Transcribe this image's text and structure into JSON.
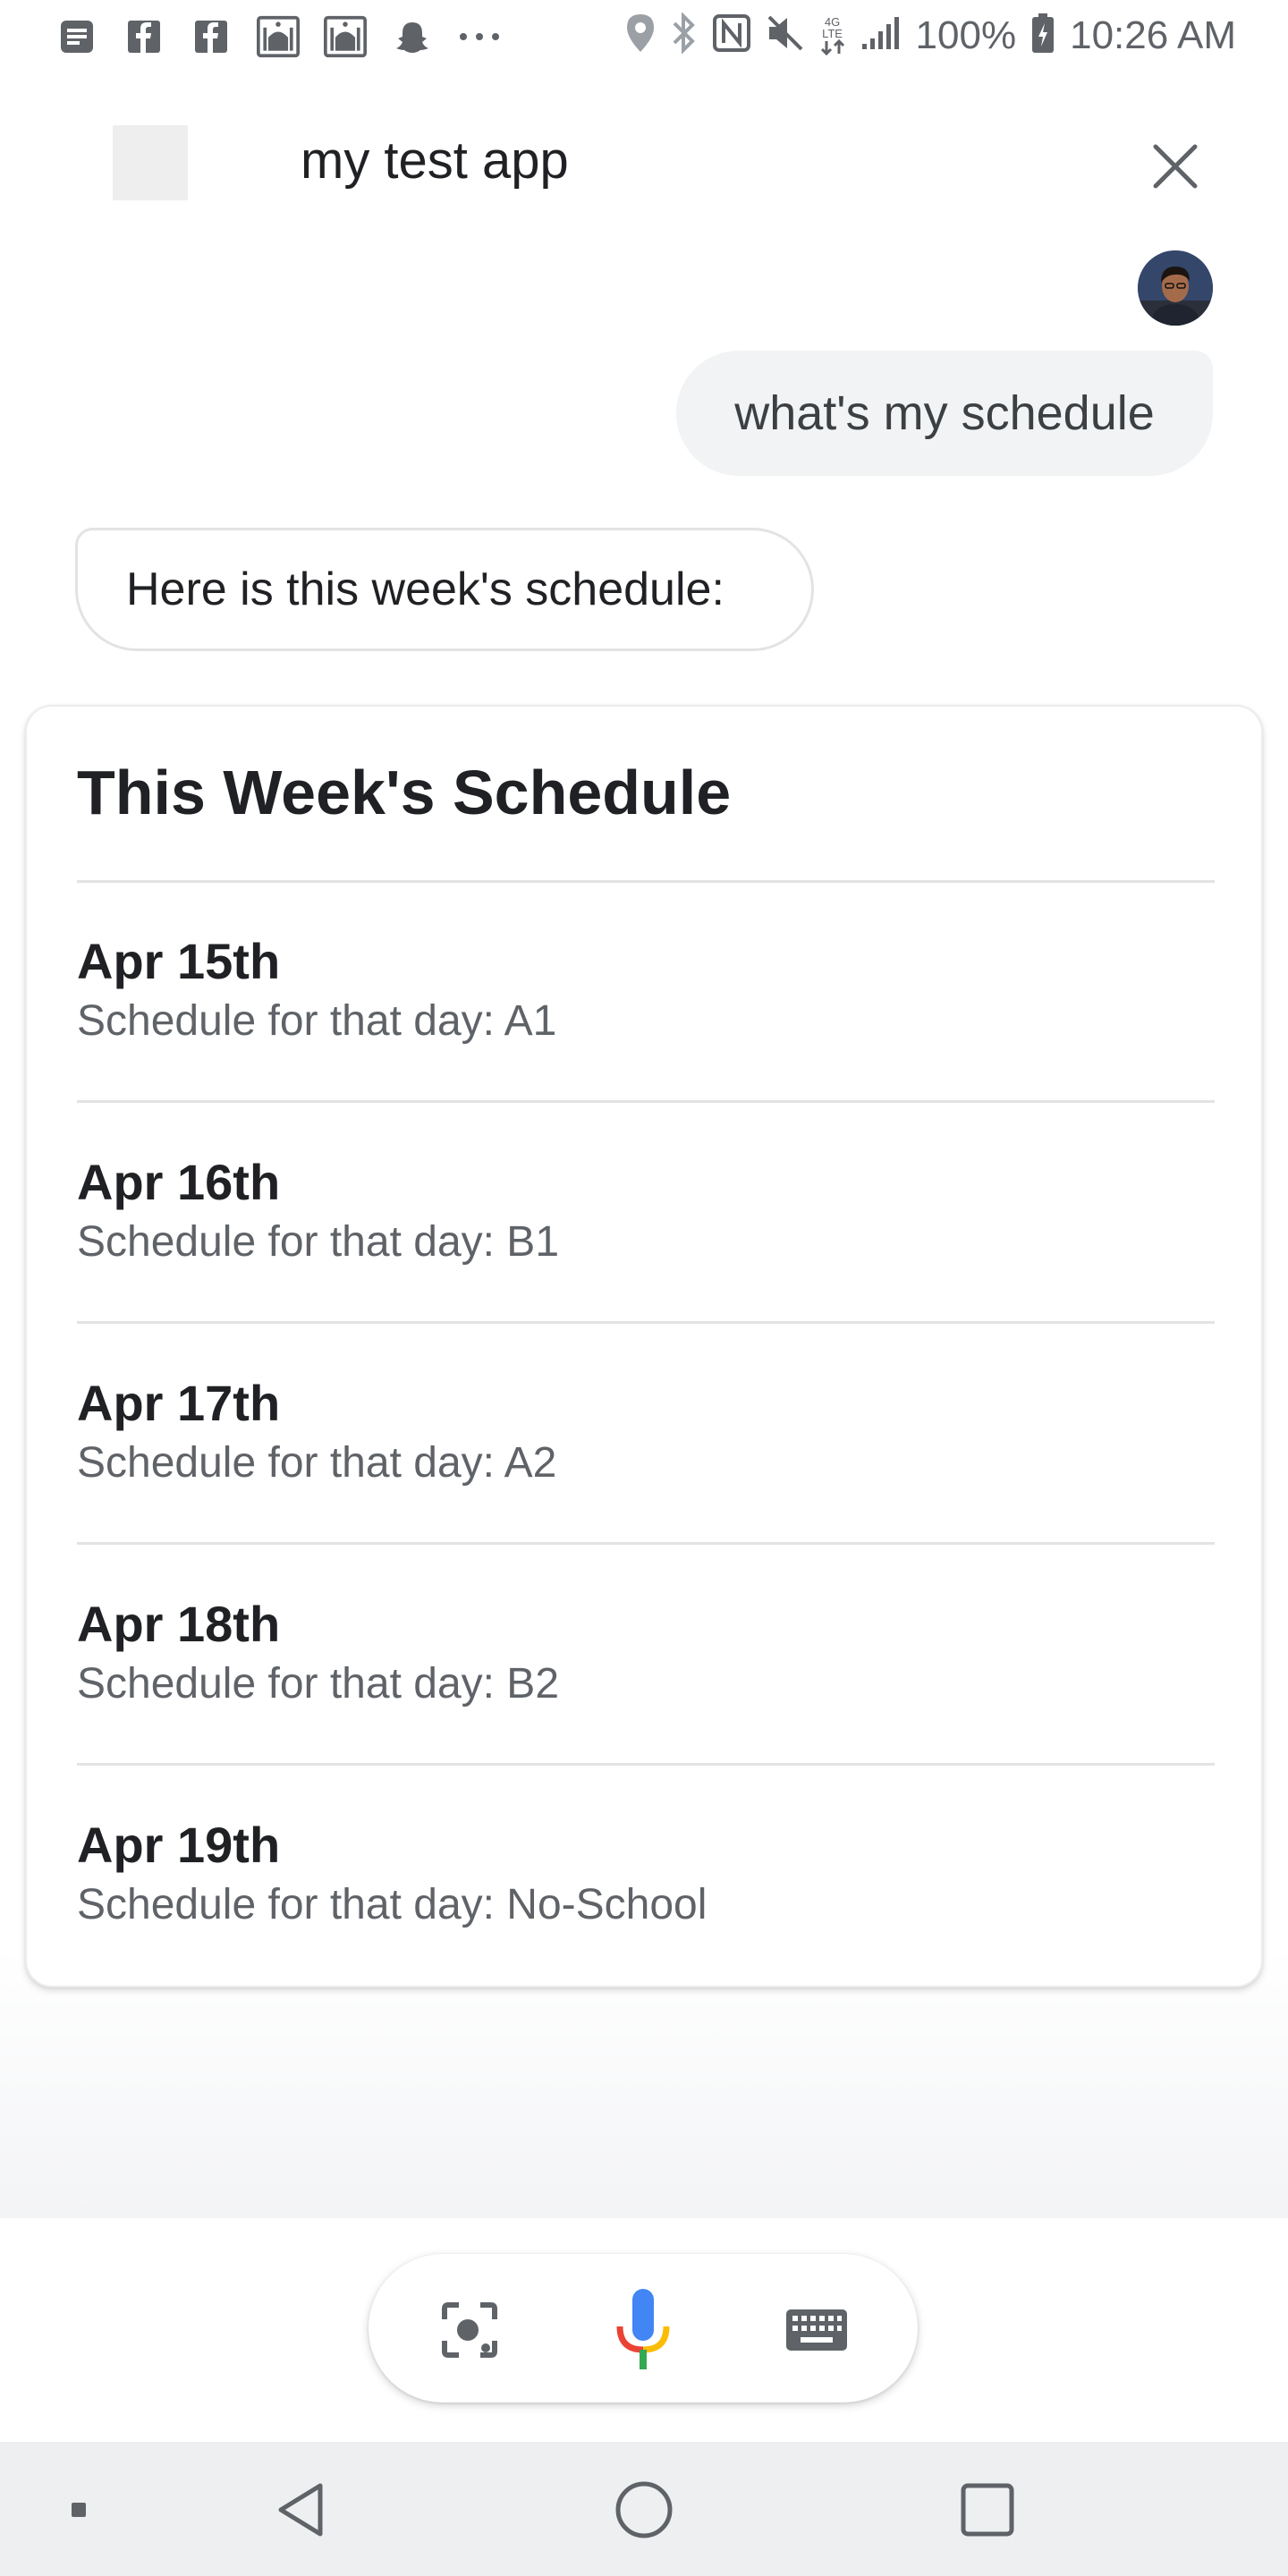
{
  "status_bar": {
    "left_icons": [
      "messages-icon",
      "facebook-icon",
      "facebook-icon",
      "mosque-icon",
      "mosque-icon",
      "snapchat-icon",
      "more-notifications-icon"
    ],
    "right_icons": [
      "location-icon",
      "bluetooth-icon",
      "nfc-icon",
      "mute-icon",
      "4g-lte-icon",
      "signal-icon",
      "battery-icon"
    ],
    "network_label": "4G LTE",
    "battery": "100%",
    "time": "10:26 AM"
  },
  "header": {
    "title": "my test app",
    "close_icon": "close-icon"
  },
  "conversation": {
    "user_message": "what's my schedule",
    "assistant_message": "Here is this week's schedule:"
  },
  "card": {
    "title": "This Week's Schedule",
    "items": [
      {
        "date": "Apr 15th",
        "detail": "Schedule for that day: A1"
      },
      {
        "date": "Apr 16th",
        "detail": "Schedule for that day: B1"
      },
      {
        "date": "Apr 17th",
        "detail": "Schedule for that day: A2"
      },
      {
        "date": "Apr 18th",
        "detail": "Schedule for that day: B2"
      },
      {
        "date": "Apr 19th",
        "detail": "Schedule for that day: No-School"
      }
    ]
  },
  "input_bar": {
    "icons": [
      "lens-icon",
      "microphone-icon",
      "keyboard-icon"
    ]
  },
  "nav_bar": {
    "icons": [
      "nav-dot-icon",
      "back-icon",
      "home-icon",
      "recents-icon"
    ]
  },
  "colors": {
    "google_blue": "#4285f4",
    "google_red": "#ea4335",
    "google_yellow": "#fbbc04",
    "google_green": "#34a853",
    "icon_gray": "#5f6368"
  }
}
